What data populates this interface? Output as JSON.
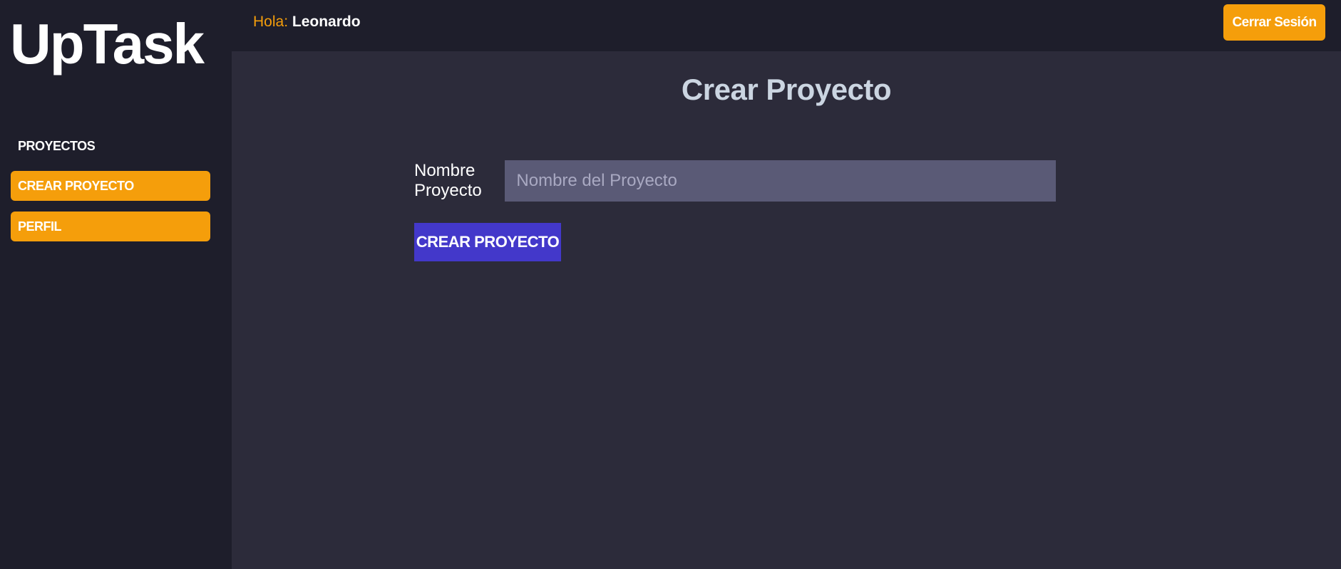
{
  "sidebar": {
    "logo": "UpTask",
    "items": [
      {
        "label": "PROYECTOS"
      },
      {
        "label": "CREAR PROYECTO"
      },
      {
        "label": "PERFIL"
      }
    ]
  },
  "header": {
    "greeting_prefix": "Hola:",
    "user_name": "Leonardo",
    "logout_label": "Cerrar Sesión"
  },
  "main": {
    "title": "Crear Proyecto",
    "form": {
      "name_label": "Nombre Proyecto",
      "name_value": "",
      "name_placeholder": "Nombre del Proyecto",
      "submit_label": "CREAR PROYECTO"
    }
  },
  "colors": {
    "accent": "#f59e0b",
    "primary": "#4338ca",
    "sidebar_bg": "#1e1e2b",
    "main_bg": "#2c2b3a",
    "input_bg": "#5a5a76"
  }
}
